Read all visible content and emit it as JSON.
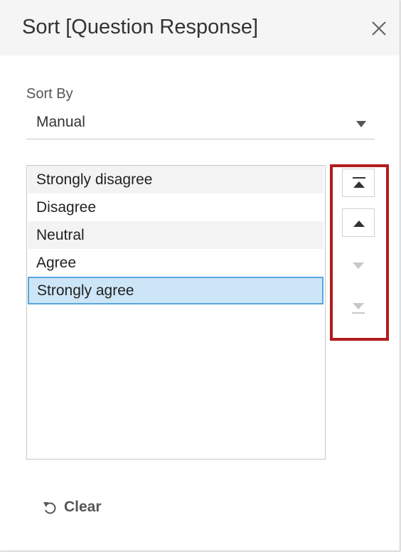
{
  "dialog": {
    "title": "Sort [Question Response]",
    "close_icon": "close-icon"
  },
  "sort_by": {
    "label": "Sort By",
    "selected_value": "Manual",
    "caret_icon": "caret-down-icon"
  },
  "list": {
    "items": [
      {
        "label": "Strongly disagree",
        "selected": false
      },
      {
        "label": "Disagree",
        "selected": false
      },
      {
        "label": "Neutral",
        "selected": false
      },
      {
        "label": "Agree",
        "selected": false
      },
      {
        "label": "Strongly agree",
        "selected": true
      }
    ]
  },
  "move_buttons": [
    {
      "icon": "move-to-top-icon",
      "enabled": true
    },
    {
      "icon": "move-up-icon",
      "enabled": true
    },
    {
      "icon": "move-down-icon",
      "enabled": false
    },
    {
      "icon": "move-to-bottom-icon",
      "enabled": false
    }
  ],
  "footer": {
    "clear_label": "Clear",
    "clear_icon": "undo-icon"
  },
  "colors": {
    "header_bg": "#f5f5f5",
    "selected_bg": "#cde6f7",
    "selected_border": "#5aa6dc",
    "annotation_red": "#b31b1b",
    "icon_enabled": "#333333",
    "icon_disabled": "#c8c8c8"
  }
}
